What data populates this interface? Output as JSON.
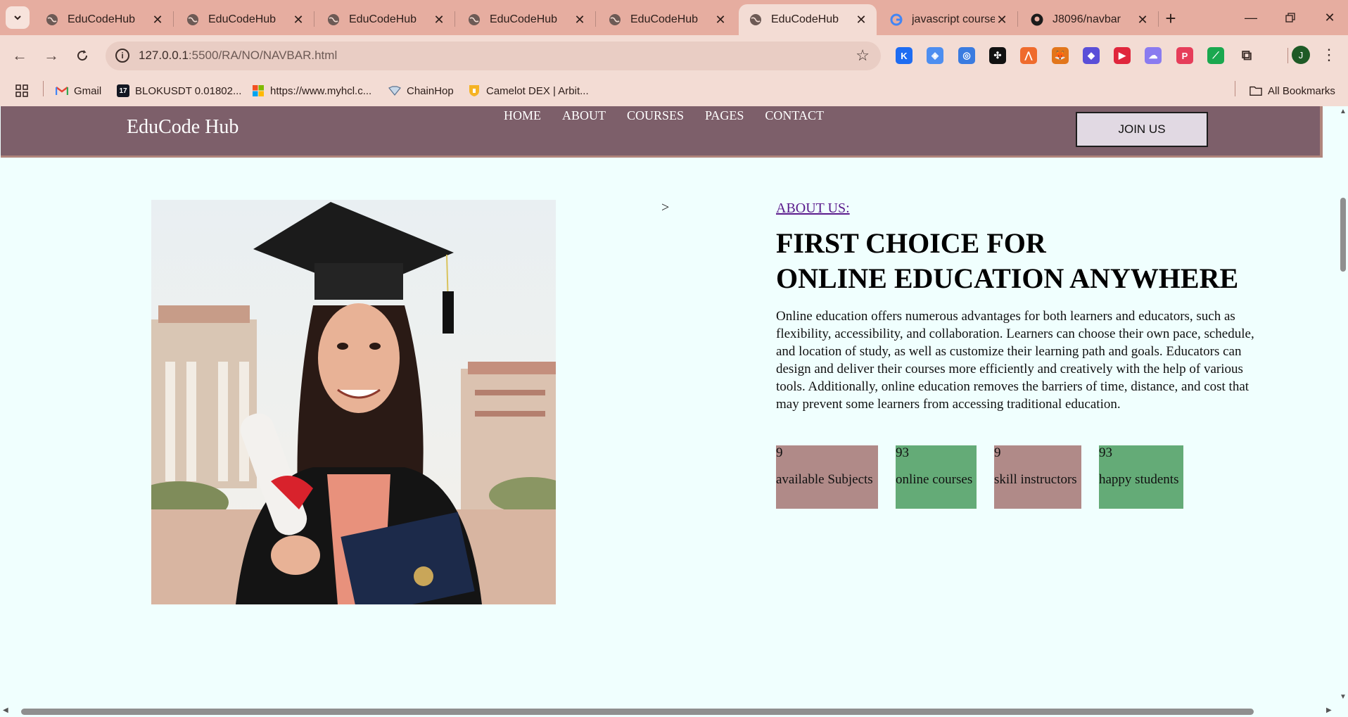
{
  "browser": {
    "tabs": [
      {
        "title": "EduCodeHub",
        "icon": "globe-icon",
        "active": false
      },
      {
        "title": "EduCodeHub",
        "icon": "globe-icon",
        "active": false
      },
      {
        "title": "EduCodeHub",
        "icon": "globe-icon",
        "active": false
      },
      {
        "title": "EduCodeHub",
        "icon": "globe-icon",
        "active": false
      },
      {
        "title": "EduCodeHub",
        "icon": "globe-icon",
        "active": false
      },
      {
        "title": "EduCodeHub",
        "icon": "globe-icon",
        "active": true
      },
      {
        "title": "javascript course",
        "icon": "google-icon",
        "active": false
      },
      {
        "title": "J8096/navbar",
        "icon": "github-icon",
        "active": false
      }
    ],
    "url_host": "127.0.0.1",
    "url_rest": ":5500/RA/NO/NAVBAR.html",
    "avatar_letter": "J",
    "bookmarks": [
      {
        "label": "Gmail",
        "icon": "gmail-icon"
      },
      {
        "label": "BLOKUSDT 0.01802...",
        "icon": "tradingview-icon"
      },
      {
        "label": "https://www.myhcl.c...",
        "icon": "microsoft-icon"
      },
      {
        "label": "ChainHop",
        "icon": "chainhop-icon"
      },
      {
        "label": "Camelot DEX | Arbit...",
        "icon": "camelot-icon"
      }
    ],
    "all_bookmarks": "All Bookmarks",
    "extensions": [
      {
        "name": "k-extension-icon",
        "color": "#1e6cf2",
        "glyph": "K"
      },
      {
        "name": "drop-extension-icon",
        "color": "#4d8ef0",
        "glyph": "◈"
      },
      {
        "name": "wave-extension-icon",
        "color": "#3a7be0",
        "glyph": "◎"
      },
      {
        "name": "dots-extension-icon",
        "color": "#111111",
        "glyph": "✣"
      },
      {
        "name": "flame-extension-icon",
        "color": "#ef6b2d",
        "glyph": "⋀"
      },
      {
        "name": "metamask-extension-icon",
        "color": "#e2761b",
        "glyph": "🦊"
      },
      {
        "name": "bird-extension-icon",
        "color": "#5a4fd8",
        "glyph": "◆"
      },
      {
        "name": "video-extension-icon",
        "color": "#e0263c",
        "glyph": "▶"
      },
      {
        "name": "cloud-extension-icon",
        "color": "#8a7bf0",
        "glyph": "☁"
      },
      {
        "name": "p-extension-icon",
        "color": "#e63d5a",
        "glyph": "P"
      },
      {
        "name": "green-extension-icon",
        "color": "#1aa84f",
        "glyph": "⟋"
      },
      {
        "name": "puzzle-extension-icon",
        "color": "#3b2c28",
        "glyph": "⧉"
      }
    ]
  },
  "site": {
    "brand": "EduCode Hub",
    "nav": [
      "HOME",
      "ABOUT",
      "COURSES",
      "PAGES",
      "CONTACT"
    ],
    "join_label": "JOIN US",
    "arrow": ">",
    "about_link": "ABOUT US:",
    "headline_1": "FIRST CHOICE FOR",
    "headline_2": "ONLINE EDUCATION ANYWHERE",
    "paragraph": "Online education offers numerous advantages for both learners and educators, such as flexibility, accessibility, and collaboration. Learners can choose their own pace, schedule, and location of study, as well as customize their learning path and goals. Educators can design and deliver their courses more efficiently and creatively with the help of various tools. Additionally, online education removes the barriers of time, distance, and cost that may prevent some learners from accessing traditional education.",
    "stats": [
      {
        "number": "9",
        "label": "available Subjects",
        "color": "#b08a88"
      },
      {
        "number": "93",
        "label": "online courses",
        "color": "#64ab77"
      },
      {
        "number": "9",
        "label": "skill instructors",
        "color": "#b08a88"
      },
      {
        "number": "93",
        "label": "happy students",
        "color": "#64ab77"
      }
    ]
  }
}
